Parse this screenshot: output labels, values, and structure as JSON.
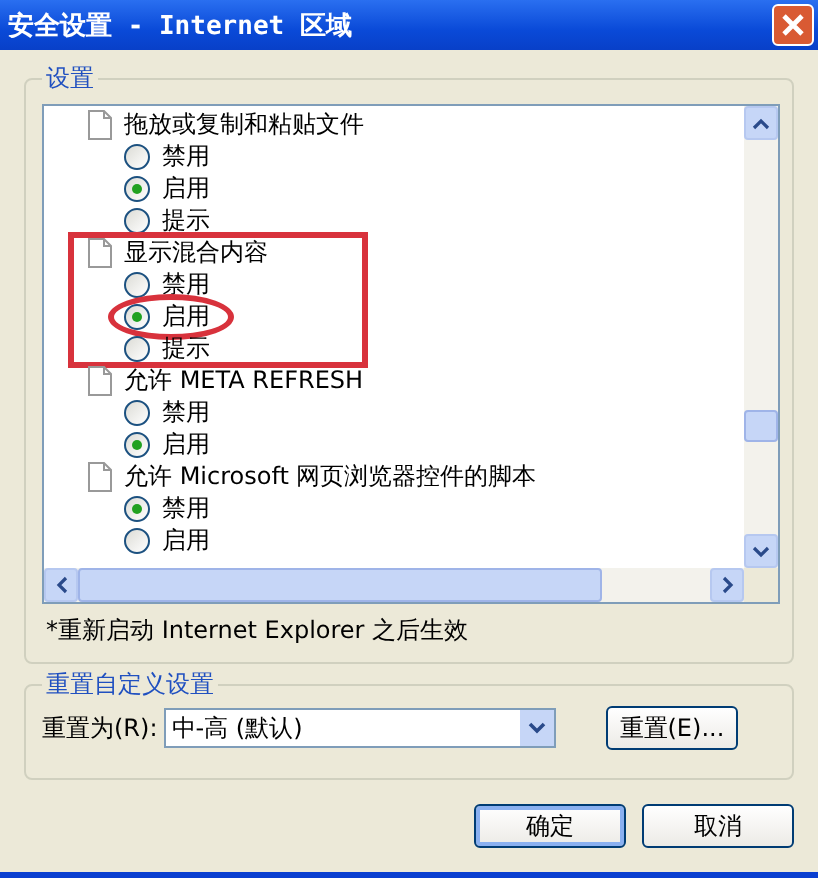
{
  "window": {
    "title": "安全设置 - Internet 区域"
  },
  "settings_group": {
    "title": "设置",
    "items": [
      {
        "label": "拖放或复制和粘贴文件",
        "highlighted": false,
        "options": [
          {
            "label": "禁用",
            "selected": false,
            "circled": false
          },
          {
            "label": "启用",
            "selected": true,
            "circled": false
          },
          {
            "label": "提示",
            "selected": false,
            "circled": false
          }
        ]
      },
      {
        "label": "显示混合内容",
        "highlighted": true,
        "options": [
          {
            "label": "禁用",
            "selected": false,
            "circled": false
          },
          {
            "label": "启用",
            "selected": true,
            "circled": true
          },
          {
            "label": "提示",
            "selected": false,
            "circled": false
          }
        ]
      },
      {
        "label": "允许 META REFRESH",
        "highlighted": false,
        "options": [
          {
            "label": "禁用",
            "selected": false,
            "circled": false
          },
          {
            "label": "启用",
            "selected": true,
            "circled": false
          }
        ]
      },
      {
        "label": "允许 Microsoft 网页浏览器控件的脚本",
        "highlighted": false,
        "options": [
          {
            "label": "禁用",
            "selected": true,
            "circled": false
          },
          {
            "label": "启用",
            "selected": false,
            "circled": false
          }
        ]
      }
    ],
    "note": "*重新启动 Internet Explorer 之后生效"
  },
  "reset_group": {
    "title": "重置自定义设置",
    "label": "重置为(R):",
    "value": "中-高 (默认)",
    "button": "重置(E)..."
  },
  "buttons": [
    "确定",
    "取消"
  ]
}
